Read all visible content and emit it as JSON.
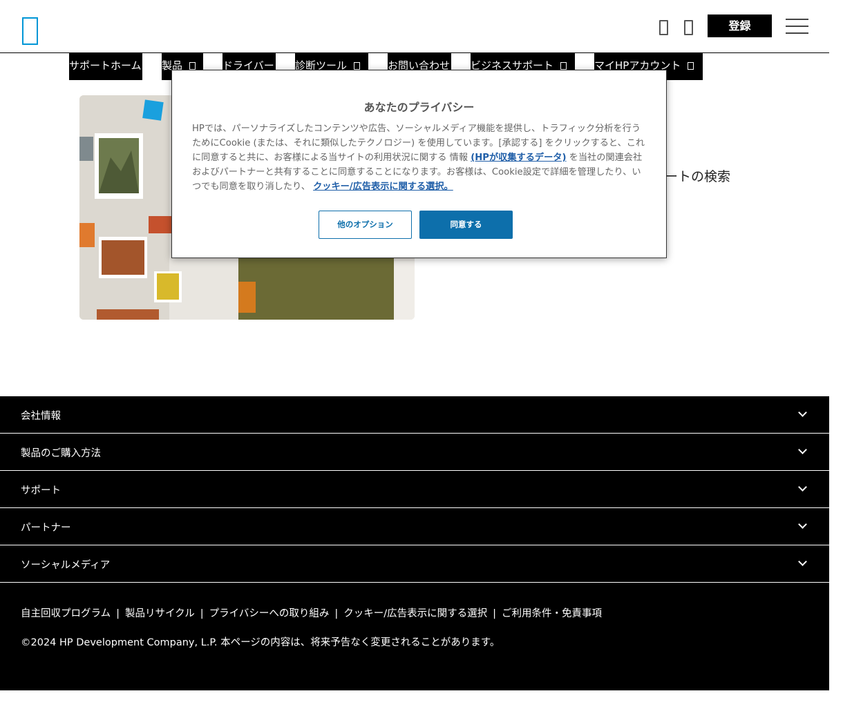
{
  "header": {
    "logo_icon": "hp-logo-icon",
    "signin_label": "登録",
    "icons": [
      "chat-icon",
      "cart-icon",
      "menu-icon"
    ]
  },
  "nav": {
    "items": [
      {
        "label": "サポートホーム"
      },
      {
        "label": "製品"
      },
      {
        "label": "ドライバー"
      },
      {
        "label": "診断ツール"
      },
      {
        "label": "お問い合わせ"
      },
      {
        "label": "ビジネスサポート"
      },
      {
        "label": "マイHPアカウント"
      }
    ]
  },
  "hero": {
    "right_text": "ートの検索"
  },
  "modal": {
    "title": "あなたのプライバシー",
    "body_1": "HPでは、パーソナライズしたコンテンツや広告、ソーシャルメディア機能を提供し、トラフィック分析を行うためにCookie (または、それに類似したテクノロジー) を使用しています。[承認する] をクリックすると、これに同意すると共に、お客様による当サイトの利用状況に関する 情報 ",
    "link_1": "(HPが収集するデータ)",
    "body_2": " を当社の関連会社およびパートナーと共有することに同意することになります。お客様は、Cookie設定で詳細を管理したり、いつでも同意を取り消したり、 ",
    "link_2": "クッキー/広告表示に関する選択。",
    "btn_other": "他のオプション",
    "btn_accept": "同意する"
  },
  "footer": {
    "sections": [
      {
        "label": "会社情報"
      },
      {
        "label": "製品のご購入方法"
      },
      {
        "label": "サポート"
      },
      {
        "label": "パートナー"
      },
      {
        "label": "ソーシャルメディア"
      }
    ],
    "links": [
      "自主回収プログラム",
      "製品リサイクル",
      "プライバシーへの取り組み",
      "クッキー/広告表示に関する選択",
      "ご利用条件・免責事項"
    ],
    "separator": "|",
    "copyright": "©2024 HP Development Company, L.P. 本ページの内容は、将来予告なく変更されることがあります。"
  },
  "colors": {
    "accent": "#0d6fab",
    "link": "#1f5ea8",
    "logo": "#0096d6",
    "footer_bg": "#000000"
  }
}
